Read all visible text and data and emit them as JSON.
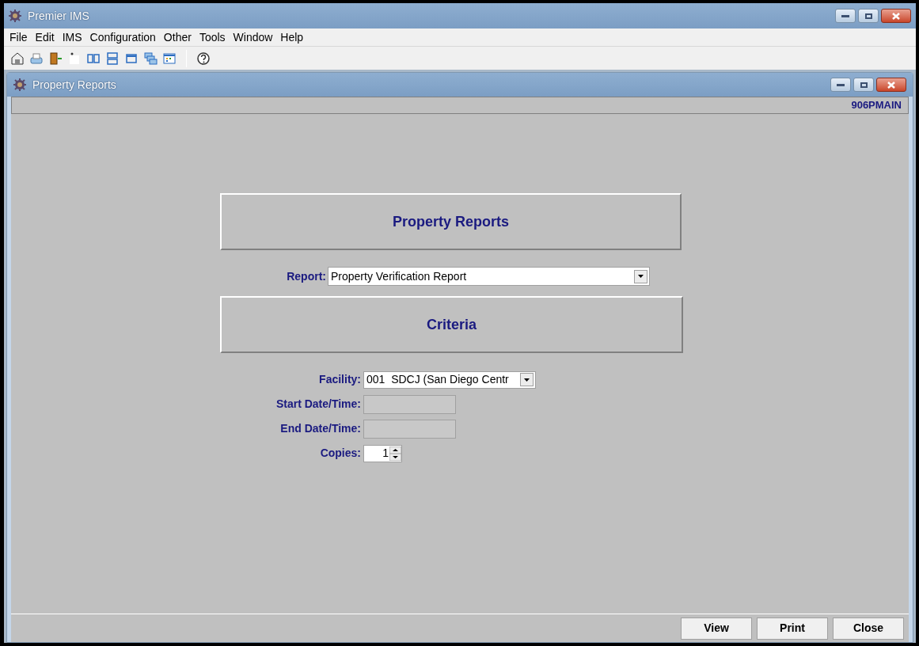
{
  "app_window": {
    "title": "Premier IMS"
  },
  "menu": [
    "File",
    "Edit",
    "IMS",
    "Configuration",
    "Other",
    "Tools",
    "Window",
    "Help"
  ],
  "toolbar": [
    {
      "kind": "properties"
    },
    {
      "kind": "print"
    },
    {
      "kind": "exit"
    },
    {
      "kind": "blank"
    },
    {
      "kind": "tile-vertical"
    },
    {
      "kind": "tile-horizontal"
    },
    {
      "kind": "window"
    },
    {
      "kind": "cascade"
    },
    {
      "kind": "calendar"
    },
    {
      "kind": "separator"
    },
    {
      "kind": "help"
    }
  ],
  "child_window": {
    "title": "Property Reports",
    "code": "906PMAIN"
  },
  "heading": "Property Reports",
  "report": {
    "label": "Report:",
    "value": "Property Verification Report"
  },
  "criteria_heading": "Criteria",
  "fields": [
    {
      "kind": "dropdown",
      "label": "Facility:",
      "value": "001  SDCJ (San Diego Centr",
      "disabled": false
    },
    {
      "kind": "text",
      "label": "Start Date/Time:",
      "disabled": true
    },
    {
      "kind": "text",
      "label": "End Date/Time:",
      "disabled": true
    },
    {
      "kind": "spinner",
      "label": "Copies:",
      "value": "1",
      "disabled": false
    }
  ],
  "buttons": [
    "View",
    "Print",
    "Close"
  ]
}
